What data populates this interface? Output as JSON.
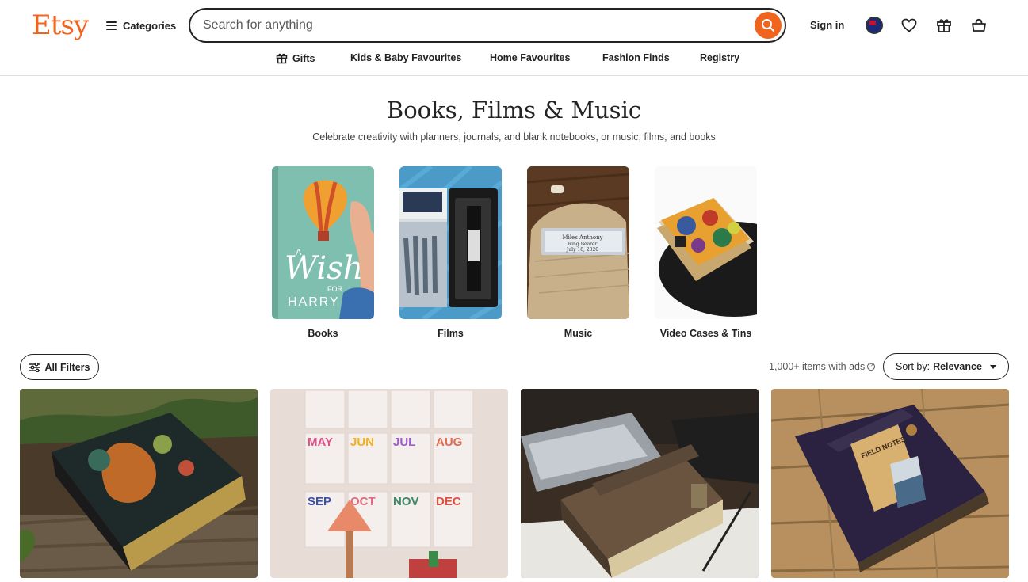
{
  "header": {
    "logo": "Etsy",
    "categories_label": "Categories",
    "search_placeholder": "Search for anything",
    "sign_in": "Sign in"
  },
  "subnav": [
    {
      "label": "Gifts",
      "icon": "gift-icon"
    },
    {
      "label": "Kids & Baby Favourites"
    },
    {
      "label": "Home Favourites"
    },
    {
      "label": "Fashion Finds"
    },
    {
      "label": "Registry"
    }
  ],
  "page": {
    "title": "Books, Films & Music",
    "subtitle": "Celebrate creativity with planners, journals, and blank notebooks, or music, films, and books"
  },
  "category_tiles": [
    {
      "label": "Books"
    },
    {
      "label": "Films"
    },
    {
      "label": "Music"
    },
    {
      "label": "Video Cases & Tins"
    }
  ],
  "book_cover": {
    "line1": "A",
    "line2": "Wish",
    "line3": "FOR",
    "line4": "HARRY"
  },
  "music_plate": {
    "line1": "Miles Anthony",
    "line2": "Ring Bearer",
    "line3": "July 18, 2020"
  },
  "calendar_months": [
    "MAY",
    "JUN",
    "JUL",
    "AUG",
    "SEP",
    "OCT",
    "NOV",
    "DEC"
  ],
  "notebook_label": "FIELD NOTES",
  "toolbar": {
    "all_filters": "All Filters",
    "items_count": "1,000+ items with ads",
    "help_glyph": "?",
    "sort_prefix": "Sort by:",
    "sort_value": "Relevance"
  },
  "colors": {
    "brand": "#f1641e",
    "text": "#222222"
  }
}
